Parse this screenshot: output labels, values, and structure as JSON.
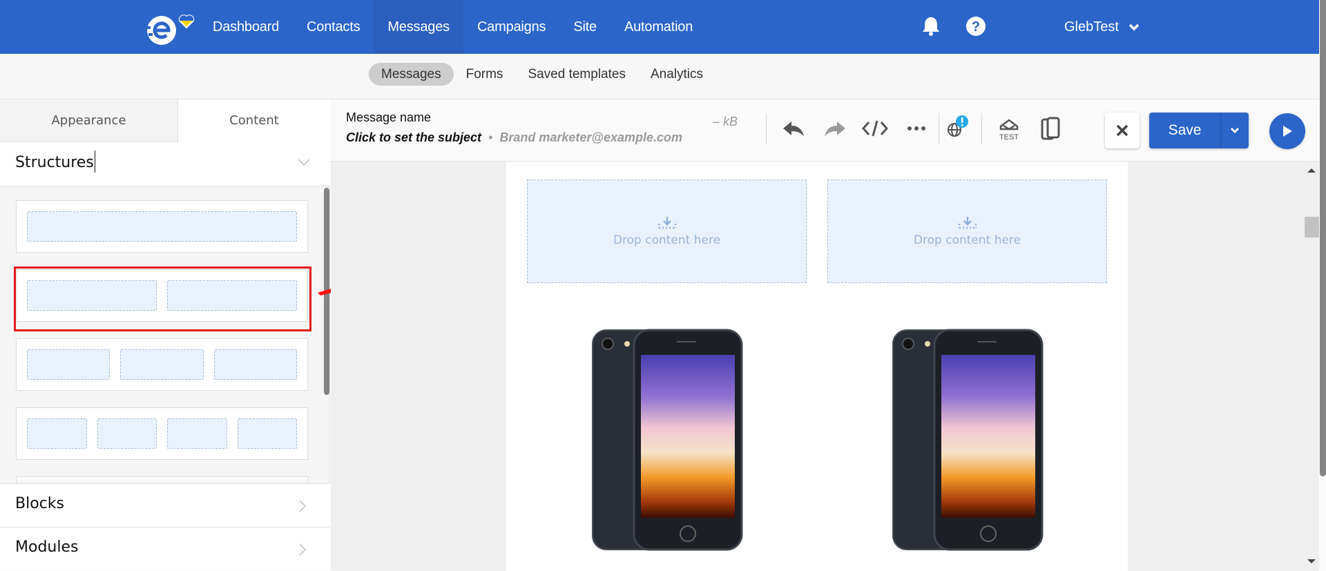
{
  "topnav": {
    "logo": "esputnik-logo",
    "items": [
      {
        "label": "Dashboard",
        "active": false
      },
      {
        "label": "Contacts",
        "active": false
      },
      {
        "label": "Messages",
        "active": true
      },
      {
        "label": "Campaigns",
        "active": false
      },
      {
        "label": "Site",
        "active": false
      },
      {
        "label": "Automation",
        "active": false
      }
    ],
    "icons": [
      "bell-icon",
      "help-icon"
    ],
    "user": "GlebTest",
    "brand_color": "#2b65c9"
  },
  "subnav": {
    "items": [
      {
        "label": "Messages",
        "active": true
      },
      {
        "label": "Forms",
        "active": false
      },
      {
        "label": "Saved templates",
        "active": false
      },
      {
        "label": "Analytics",
        "active": false
      }
    ]
  },
  "left_panel": {
    "tabs": [
      {
        "label": "Appearance",
        "active": false
      },
      {
        "label": "Content",
        "active": true
      }
    ],
    "section_title": "Structures",
    "structures": [
      {
        "columns": 1
      },
      {
        "columns": 2,
        "highlighted": true
      },
      {
        "columns": 3
      },
      {
        "columns": 4
      }
    ],
    "accordions": [
      {
        "label": "Blocks"
      },
      {
        "label": "Modules"
      }
    ],
    "highlight_color": "#e41c1c"
  },
  "editor_header": {
    "message_name": "Message name",
    "subject_placeholder": "Click to set the subject",
    "sender_separator": "•",
    "sender": "Brand marketer@example.com",
    "size": "– kB",
    "toolbar": [
      "undo-icon",
      "redo-icon",
      "code-icon",
      "more-icon",
      "globe-warning-icon",
      "test-icon",
      "mobile-preview-icon"
    ],
    "test_label": "TEST",
    "save_label": "Save"
  },
  "canvas": {
    "drop_zones": [
      {
        "label": "Drop content here"
      },
      {
        "label": "Drop content here"
      }
    ],
    "images": [
      "phone-image",
      "phone-image"
    ]
  }
}
